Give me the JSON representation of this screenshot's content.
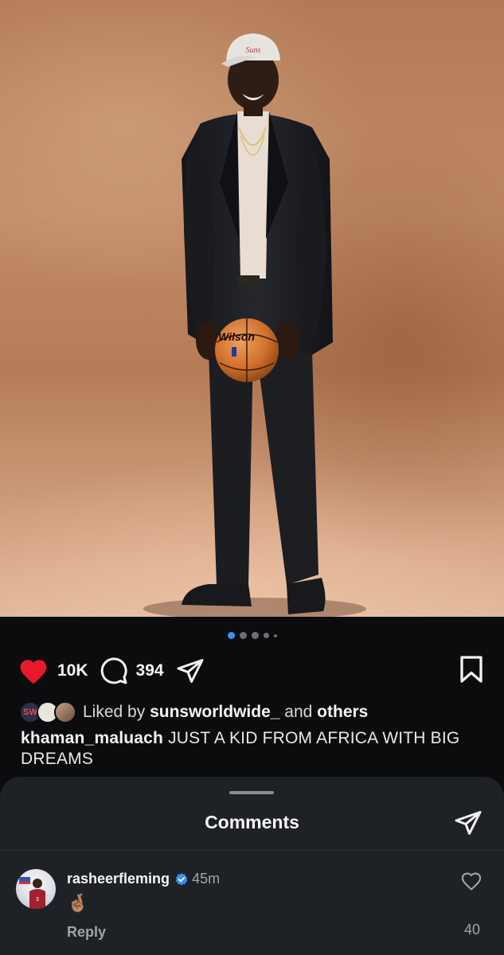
{
  "post": {
    "likes_count": "10K",
    "comments_count": "394",
    "liked_by_prefix": "Liked by",
    "liked_by_user": "sunsworldwide_",
    "liked_by_and": "and",
    "liked_by_others": "others",
    "avatar_badge_text": "SW",
    "caption_user": "khaman_maluach",
    "caption_text": "JUST A KID FROM AFRICA WITH BIG DREAMS",
    "ball_brand": "Wilson",
    "carousel": {
      "total": 5,
      "active_index": 0
    },
    "like_color": "#e8192c"
  },
  "comments_sheet": {
    "title": "Comments",
    "comments": [
      {
        "username": "rasheerfleming",
        "verified": true,
        "time": "45m",
        "text": "🤞🏽",
        "reply_label": "Reply",
        "like_count": "40"
      }
    ]
  },
  "colors": {
    "accent": "#3b8ff6",
    "background": "#0b0c0e",
    "sheet": "#1e2226"
  }
}
